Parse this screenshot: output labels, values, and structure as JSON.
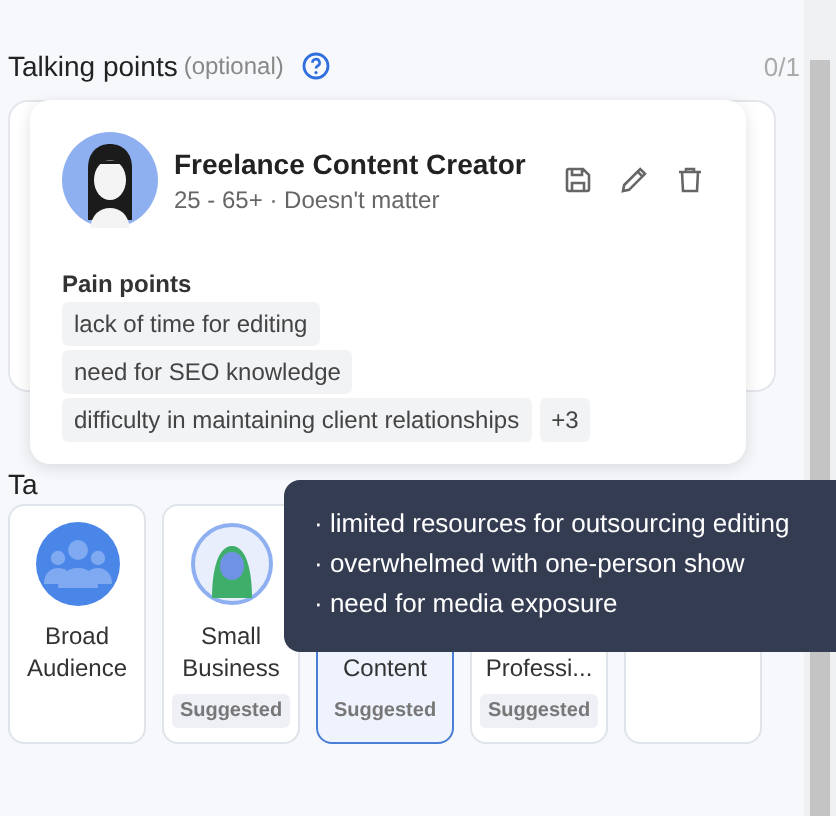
{
  "section": {
    "title": "Talking points",
    "hint": "(optional)",
    "counter": "0/1"
  },
  "persona": {
    "name": "Freelance Content Creator",
    "meta": "25 - 65+ · Doesn't matter",
    "pain_label": "Pain points",
    "pain_points": [
      "lack of time for editing",
      "need for SEO knowledge",
      "difficulty in maintaining client relationships"
    ],
    "more": "+3"
  },
  "next_label": "Ta",
  "audiences": [
    {
      "name": "Broad Audience",
      "kind": "group",
      "selected": false
    },
    {
      "name": "Small Business",
      "kind": "figure",
      "tag": "Suggested",
      "selected": false
    },
    {
      "name": "Content",
      "kind": "hidden",
      "tag": "Suggested",
      "selected": true
    },
    {
      "name": "Professi...",
      "kind": "hidden",
      "tag": "Suggested",
      "selected": false
    },
    {
      "kind": "hidden",
      "selected": false
    }
  ],
  "tooltip": [
    "· limited resources for outsourcing editing",
    "· overwhelmed with one-person show",
    "· need for media exposure"
  ]
}
